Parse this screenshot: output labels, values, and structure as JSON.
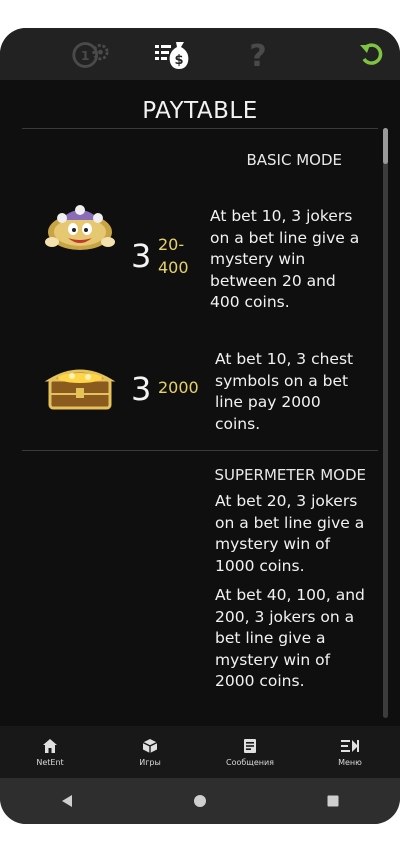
{
  "toolbar": {
    "coins_icon": "coins-settings-icon",
    "paytable_icon": "paytable-moneybag-icon",
    "help_icon": "question-icon",
    "back_icon": "return-arrow-icon",
    "accent_color": "#7ec341"
  },
  "paytable": {
    "title": "PAYTABLE",
    "basic": {
      "heading": "BASIC MODE",
      "joker": {
        "symbol": "jester-joker",
        "count": "3",
        "pay_line1": "20-",
        "pay_line2": "400",
        "description": "At bet 10, 3 jokers on a bet line give a mystery win between 20 and 400 coins."
      },
      "chest": {
        "symbol": "treasure-chest",
        "count": "3",
        "pay": "2000",
        "description": "At bet 10, 3 chest symbols on a bet line pay 2000 coins."
      }
    },
    "supermeter": {
      "heading": "SUPERMETER MODE",
      "text1": "At bet 20, 3 jokers on a bet line give a mystery win of 1000 coins.",
      "text2": "At bet 40, 100, and 200, 3 jokers on a bet line give a mystery win of 2000 coins."
    },
    "pay_color": "#e7d26a"
  },
  "bottom_nav": {
    "items": [
      {
        "label": "NetEnt",
        "icon": "home-icon"
      },
      {
        "label": "Игры",
        "icon": "cube-icon"
      },
      {
        "label": "Сообщения",
        "icon": "messages-icon"
      },
      {
        "label": "Меню",
        "icon": "menu-icon"
      }
    ]
  },
  "system_nav": {
    "back": "back-triangle-icon",
    "home": "home-circle-icon",
    "recents": "recents-square-icon"
  }
}
